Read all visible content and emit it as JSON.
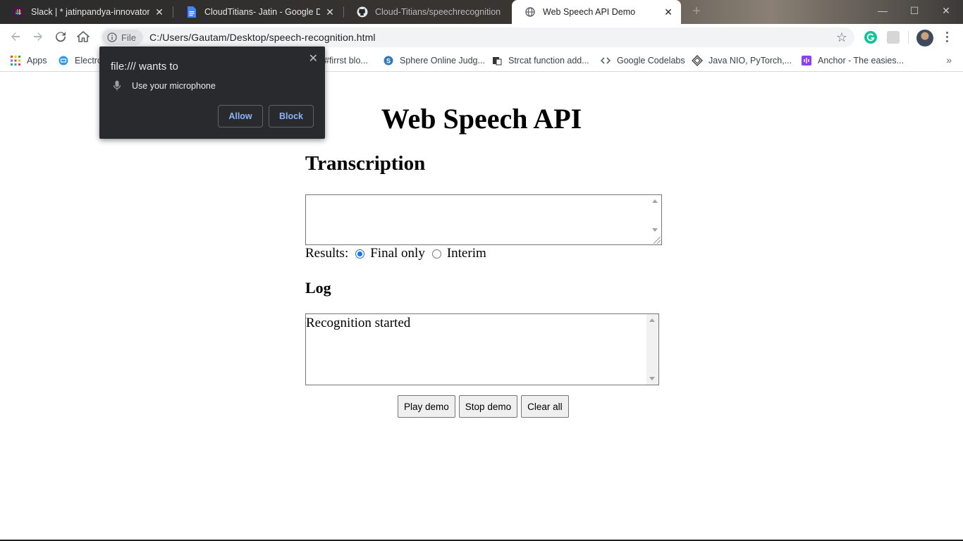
{
  "browser": {
    "tabs": [
      {
        "title": "Slack | * jatinpandya-innovator | C",
        "icon": "slack-icon"
      },
      {
        "title": "CloudTitians- Jatin - Google Docs",
        "icon": "google-docs-icon"
      },
      {
        "title": "Cloud-Titians/speechrecognition",
        "icon": "github-icon"
      },
      {
        "title": "Web Speech API Demo",
        "icon": "globe-icon"
      }
    ],
    "new_tab": "+",
    "window_controls": {
      "minimize": "—",
      "maximize": "☐",
      "close": "✕"
    },
    "address": {
      "chip_label": "File",
      "url": "C:/Users/Gautam/Desktop/speech-recognition.html"
    },
    "bookmarks": [
      {
        "label": "Apps",
        "icon": "apps-grid-icon"
      },
      {
        "label": "Electro",
        "icon": "electron-icon"
      },
      {
        "label": "#firrst blo...",
        "icon": "bookmark-icon"
      },
      {
        "label": "Sphere Online Judg...",
        "icon": "spoj-icon"
      },
      {
        "label": "Strcat function add...",
        "icon": "page-icon"
      },
      {
        "label": "Google Codelabs",
        "icon": "codelabs-icon"
      },
      {
        "label": "Java NIO, PyTorch,...",
        "icon": "diamond-icon"
      },
      {
        "label": "Anchor - The easies...",
        "icon": "anchor-icon"
      }
    ],
    "bookmarks_more": "»"
  },
  "popup": {
    "title": "file:/// wants to",
    "permission": "Use your microphone",
    "allow": "Allow",
    "block": "Block",
    "close": "✕"
  },
  "page": {
    "title": "Web Speech API",
    "transcription_heading": "Transcription",
    "transcription_value": "",
    "results_label": "Results:",
    "options": [
      {
        "label": "Final only",
        "checked": true
      },
      {
        "label": "Interim",
        "checked": false
      }
    ],
    "log_heading": "Log",
    "log_value": "Recognition started",
    "buttons": {
      "play": "Play demo",
      "stop": "Stop demo",
      "clear": "Clear all"
    }
  },
  "colors": {
    "accent": "#1a73e8",
    "popup_bg": "#292a2d",
    "popup_button_text": "#8ab4f8"
  }
}
